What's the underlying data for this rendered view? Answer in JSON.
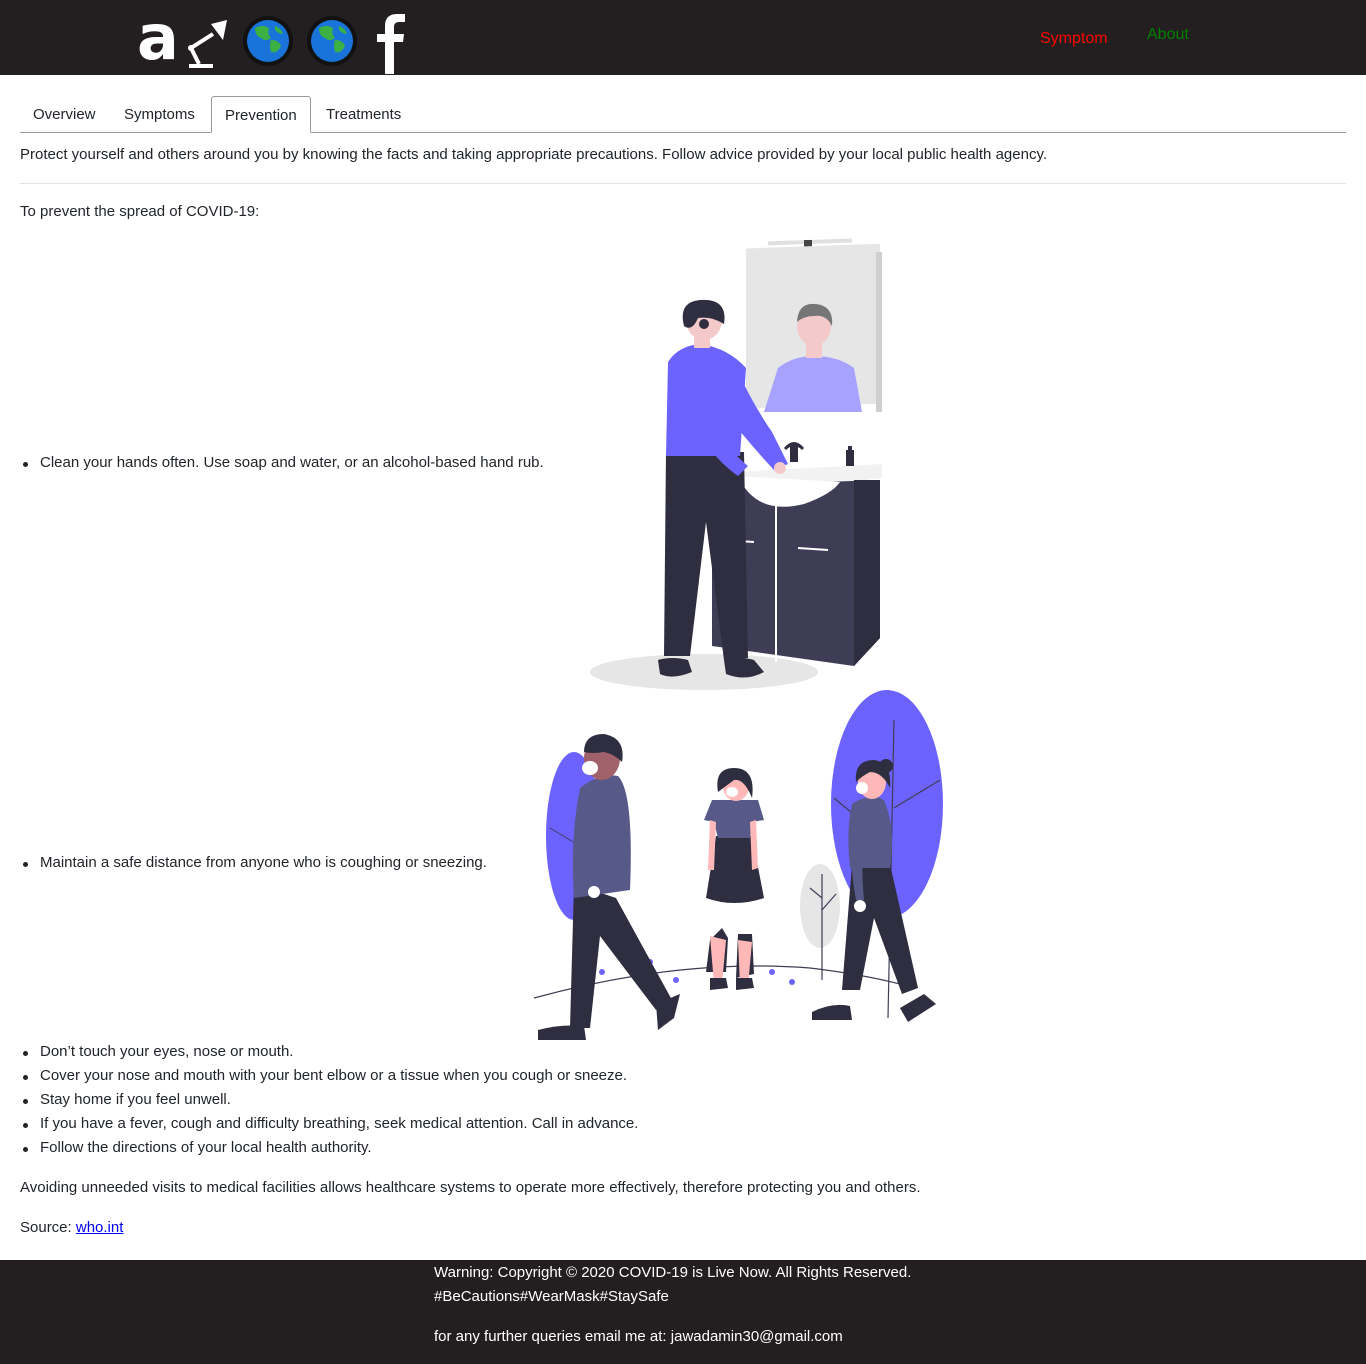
{
  "header": {
    "logo_letter": "a",
    "icons": [
      "lamp-icon",
      "globe-icon",
      "globe-icon",
      "facebook-icon"
    ],
    "nav": [
      {
        "label": "Symptom",
        "color": "#ff0000"
      },
      {
        "label": "About",
        "color": "#008000"
      }
    ],
    "background": "#231f20"
  },
  "tabs": [
    {
      "label": "Overview",
      "active": false
    },
    {
      "label": "Symptoms",
      "active": false
    },
    {
      "label": "Prevention",
      "active": true
    },
    {
      "label": "Treatments",
      "active": false
    }
  ],
  "content": {
    "intro": "Protect yourself and others around you by knowing the facts and taking appropriate precautions. Follow advice provided by your local public health agency.",
    "lead": "To prevent the spread of COVID-19:",
    "bullets": [
      "Clean your hands often. Use soap and water, or an alcohol-based hand rub.",
      "Maintain a safe distance from anyone who is coughing or sneezing.",
      "Don’t touch your eyes, nose or mouth.",
      "Cover your nose and mouth with your bent elbow or a tissue when you cough or sneeze.",
      "Stay home if you feel unwell.",
      "If you have a fever, cough and difficulty breathing, seek medical attention. Call in advance.",
      "Follow the directions of your local health authority."
    ],
    "closing": "Avoiding unneeded visits to medical facilities allows healthcare systems to operate more effectively, therefore protecting you and others.",
    "source_label": "Source:",
    "source_link": "who.int",
    "accent_color": "#6c63ff"
  },
  "footer": {
    "line1": "Warning: Copyright © 2020 COVID-19 is Live Now. All Rights Reserved.",
    "line2": "#BeCautions#WearMask#StaySafe",
    "line3": "for any further queries email me at: jawadamin30@gmail.com"
  }
}
